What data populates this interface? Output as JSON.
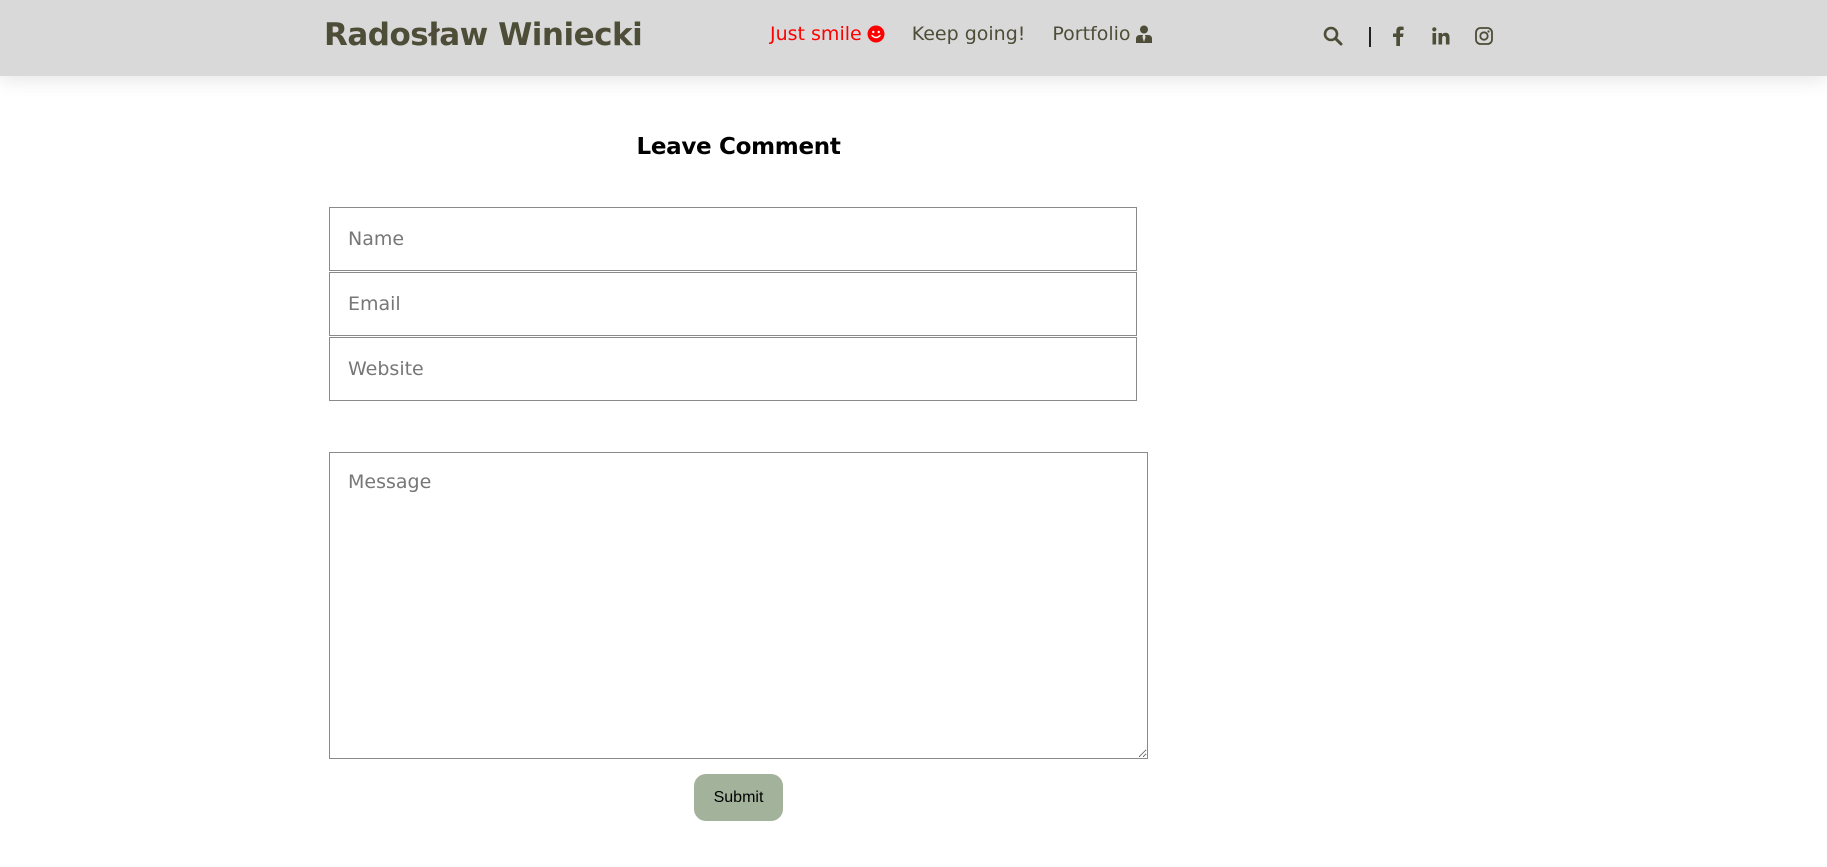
{
  "header": {
    "brand": "Radosław Winiecki",
    "nav": [
      {
        "label": "Just smile",
        "icon": "smile-icon",
        "active": true
      },
      {
        "label": "Keep going!",
        "icon": null,
        "active": false
      },
      {
        "label": "Portfolio",
        "icon": "user-tie-icon",
        "active": false
      }
    ],
    "tools": [
      "search-icon",
      "facebook-icon",
      "linkedin-icon",
      "instagram-icon"
    ]
  },
  "form": {
    "title": "Leave Comment",
    "name_placeholder": "Name",
    "email_placeholder": "Email",
    "website_placeholder": "Website",
    "message_placeholder": "Message",
    "submit_label": "Submit"
  },
  "colors": {
    "header_bg": "#d9d9d9",
    "brand_text": "#4d4d38",
    "active_nav": "#ff0000",
    "submit_bg": "#a3b29a",
    "field_border": "#8a8a8a"
  }
}
